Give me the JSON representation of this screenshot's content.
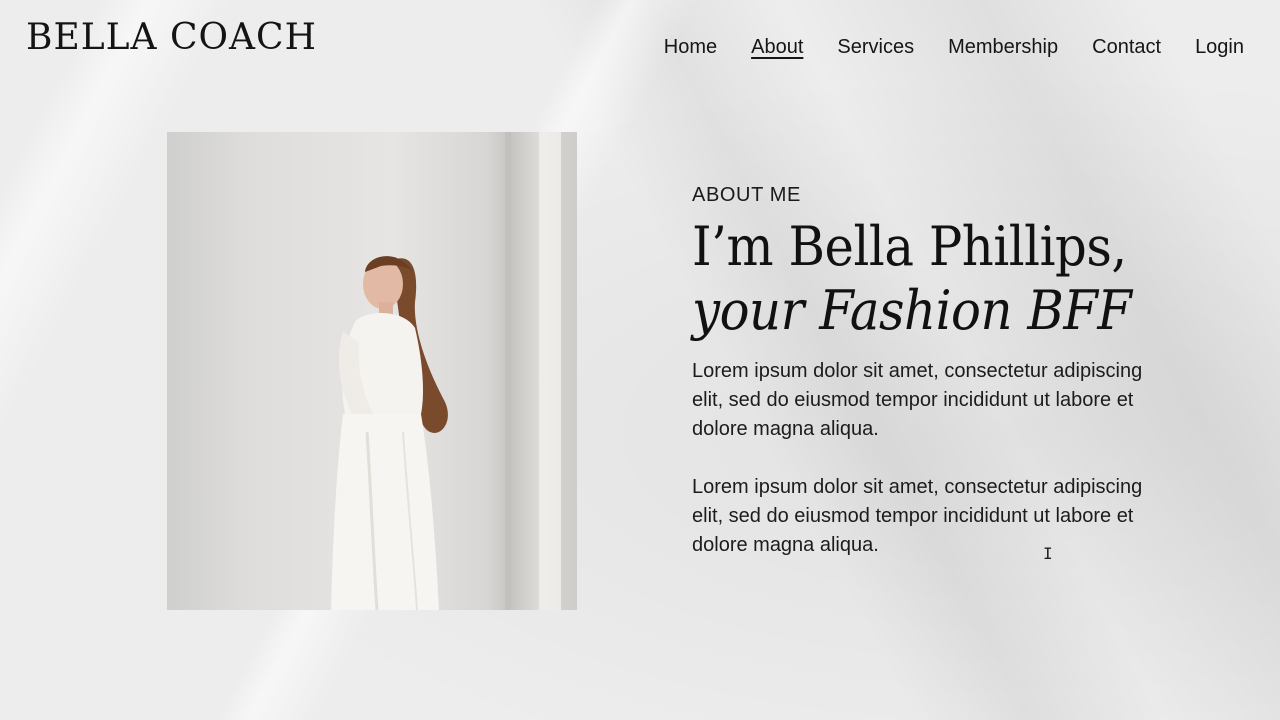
{
  "brand": {
    "logo_text": "BELLA COACH"
  },
  "nav": {
    "items": [
      {
        "label": "Home",
        "active": false
      },
      {
        "label": "About",
        "active": true
      },
      {
        "label": "Services",
        "active": false
      },
      {
        "label": "Membership",
        "active": false
      },
      {
        "label": "Contact",
        "active": false
      },
      {
        "label": "Login",
        "active": false
      }
    ]
  },
  "about": {
    "eyebrow": "ABOUT ME",
    "headline_line1": "I’m Bella Phillips,",
    "headline_line2": "your Fashion BFF",
    "paragraphs": [
      "Lorem ipsum dolor sit amet, consectetur adipiscing elit, sed do eiusmod tempor incididunt ut labore et dolore magna aliqua.",
      "Lorem ipsum dolor sit amet, consectetur adipiscing elit, sed do eiusmod tempor incididunt ut labore et dolore magna aliqua."
    ]
  },
  "icons": {
    "text_cursor": "text-cursor-icon"
  },
  "colors": {
    "background": "#ededed",
    "text": "#1a1a1a"
  }
}
